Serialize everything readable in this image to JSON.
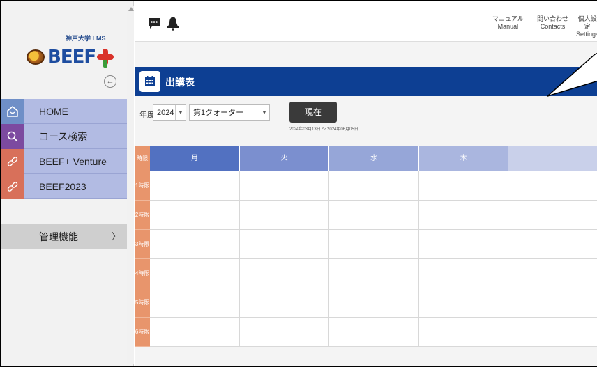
{
  "sidebar": {
    "university": "神戸大学 LMS",
    "brand": "BEEF",
    "nav": [
      {
        "label": "HOME",
        "icon": "home-icon",
        "color": "#6f8fc7"
      },
      {
        "label": "コース検索",
        "icon": "search-icon",
        "color": "#7c4aa0"
      },
      {
        "label": "BEEF+ Venture",
        "icon": "link-icon",
        "color": "#d8705a"
      },
      {
        "label": "BEEF2023",
        "icon": "link-icon",
        "color": "#d8705a"
      }
    ],
    "admin": {
      "label": "管理機能",
      "chevron": "〉"
    }
  },
  "header": {
    "icons": [
      "chat-icon",
      "bell-icon"
    ],
    "links": [
      {
        "ja": "マニュアル",
        "en": "Manual"
      },
      {
        "ja": "問い合わせ",
        "en": "Contacts"
      },
      {
        "ja": "個人設定",
        "en": "Settings"
      }
    ]
  },
  "page": {
    "title": "出講表",
    "title_icon": "calendar-icon",
    "accent": "#0d3f93"
  },
  "filters": {
    "year_label": "年度",
    "year_value": "2024",
    "quarter_value": "第1クォーター",
    "now_button": "現在",
    "date_range": "2024年03月13日 ～ 2024年06月05日"
  },
  "timetable": {
    "corner": "時限",
    "days": [
      "月",
      "火",
      "水",
      "木",
      ""
    ],
    "day_colors": [
      "#5271c1",
      "#7b8fcf",
      "#96a6d8",
      "#aab6df",
      "#c9d0ea"
    ],
    "periods": [
      "1時限",
      "2時限",
      "3時限",
      "4時限",
      "5時限",
      "6時限"
    ]
  }
}
